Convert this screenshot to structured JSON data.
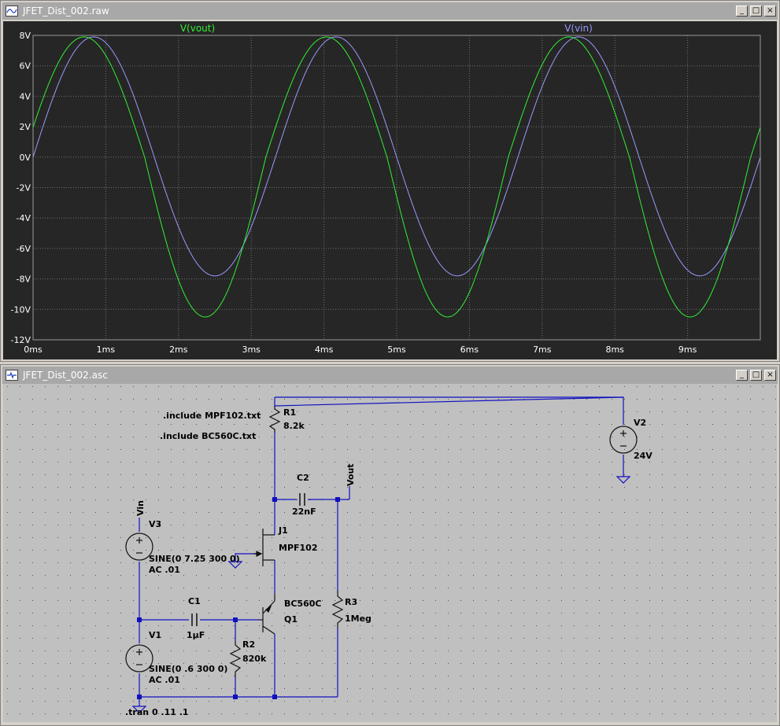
{
  "plot_window": {
    "title": "JFET_Dist_002.raw",
    "trace_labels": [
      {
        "name": "V(vout)",
        "color": "#33ee33"
      },
      {
        "name": "V(vin)",
        "color": "#9999ff"
      }
    ],
    "y_ticks": [
      "8V",
      "6V",
      "4V",
      "2V",
      "0V",
      "-2V",
      "-4V",
      "-6V",
      "-8V",
      "-10V",
      "-12V"
    ],
    "x_ticks": [
      "0ms",
      "1ms",
      "2ms",
      "3ms",
      "4ms",
      "5ms",
      "6ms",
      "7ms",
      "8ms",
      "9ms"
    ]
  },
  "chart_data": {
    "type": "line",
    "xlabel": "",
    "ylabel": "",
    "xlim_ms": [
      0,
      10
    ],
    "ylim_V": [
      -12,
      8
    ],
    "grid": true,
    "series": [
      {
        "name": "V(vout)",
        "color": "#33ee33",
        "frequency_hz": 300,
        "amplitude_pos_V": 7.9,
        "amplitude_neg_V": -10.5,
        "offset_at_zero_V": 2.0
      },
      {
        "name": "V(vin)",
        "color": "#9999ff",
        "frequency_hz": 300,
        "amplitude_pos_V": 7.9,
        "amplitude_neg_V": -7.8,
        "offset_at_zero_V": 0.0
      }
    ]
  },
  "schematic_window": {
    "title": "JFET_Dist_002.asc",
    "directives": {
      "include1": ".include MPF102.txt",
      "include2": ".include BC560C.txt",
      "tran": ".tran 0 .11 .1"
    },
    "components": {
      "r1_name": "R1",
      "r1_value": "8.2k",
      "r2_name": "R2",
      "r2_value": "820k",
      "r3_name": "R3",
      "r3_value": "1Meg",
      "c1_name": "C1",
      "c1_value": "1µF",
      "c2_name": "C2",
      "c2_value": "22nF",
      "j1_name": "J1",
      "j1_value": "MPF102",
      "q1_name": "Q1",
      "q1_value": "BC560C",
      "v1_name": "V1",
      "v1_value": "SINE(0 .6 300 0)",
      "v1_ac": "AC .01",
      "v2_name": "V2",
      "v2_value": "24V",
      "v3_name": "V3",
      "v3_value": "SINE(0 7.25 300 0)",
      "v3_ac": "AC .01"
    },
    "nets": {
      "vin": "Vin",
      "vout": "Vout"
    }
  },
  "window_controls": {
    "minimize": "_",
    "maximize": "□",
    "close": "×"
  },
  "colors": {
    "titlebar": "#a8a8a8",
    "plot_bg": "#262626",
    "grid": "#707070",
    "sch_bg": "#c0c0c0",
    "wire": "#1010c0"
  }
}
